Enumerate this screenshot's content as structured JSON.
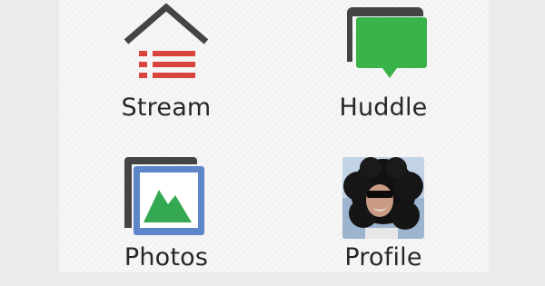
{
  "tiles": [
    {
      "label": "Stream",
      "icon": "stream-house-list-icon"
    },
    {
      "label": "Huddle",
      "icon": "huddle-chat-bubble-icon"
    },
    {
      "label": "Photos",
      "icon": "photos-gallery-icon"
    },
    {
      "label": "Profile",
      "icon": "profile-avatar-photo"
    }
  ],
  "colors": {
    "background": "#f6f6f6",
    "icon_dark": "#444444",
    "stream_red": "#d9453d",
    "huddle_green": "#3ab34a",
    "photo_blue": "#5c86c8",
    "photo_green": "#34a853",
    "label": "#262626"
  }
}
